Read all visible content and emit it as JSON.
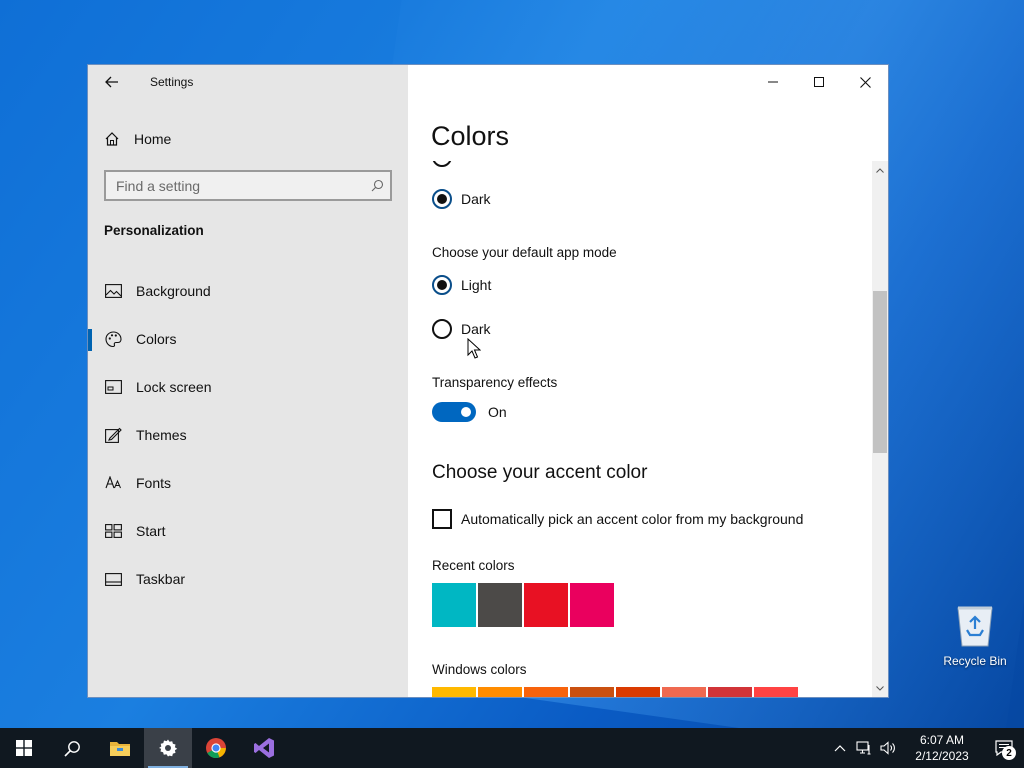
{
  "window": {
    "app_title": "Settings"
  },
  "sidebar": {
    "home_label": "Home",
    "search_placeholder": "Find a setting",
    "section_heading": "Personalization",
    "items": [
      {
        "label": "Background",
        "icon": "picture-icon"
      },
      {
        "label": "Colors",
        "icon": "palette-icon",
        "active": true
      },
      {
        "label": "Lock screen",
        "icon": "lock-screen-icon"
      },
      {
        "label": "Themes",
        "icon": "themes-icon"
      },
      {
        "label": "Fonts",
        "icon": "fonts-icon"
      },
      {
        "label": "Start",
        "icon": "start-icon"
      },
      {
        "label": "Taskbar",
        "icon": "taskbar-icon"
      }
    ]
  },
  "main": {
    "page_title": "Colors",
    "windows_mode": {
      "selected_label": "Dark"
    },
    "app_mode": {
      "heading": "Choose your default app mode",
      "options": [
        {
          "label": "Light",
          "checked": true
        },
        {
          "label": "Dark",
          "checked": false
        }
      ]
    },
    "transparency": {
      "heading": "Transparency effects",
      "state_label": "On",
      "on": true
    },
    "accent": {
      "title": "Choose your accent color",
      "auto_pick_label": "Automatically pick an accent color from my background",
      "auto_pick_checked": false,
      "recent_heading": "Recent colors",
      "recent_colors": [
        "#00b7c3",
        "#4c4a48",
        "#e81123",
        "#ea005e"
      ],
      "windows_heading": "Windows colors",
      "windows_colors": [
        "#ffb900",
        "#ff8c00",
        "#f7630c",
        "#ca5010",
        "#da3b01",
        "#ef6950",
        "#d13438",
        "#ff4343"
      ]
    }
  },
  "desktop": {
    "recycle_bin_label": "Recycle Bin"
  },
  "taskbar": {
    "clock_time": "6:07 AM",
    "clock_date": "2/12/2023",
    "notification_count": "2"
  },
  "colors": {
    "accent": "#0067c0",
    "sidebar_bg": "#e6e6e6",
    "taskbar_bg": "#101820"
  }
}
